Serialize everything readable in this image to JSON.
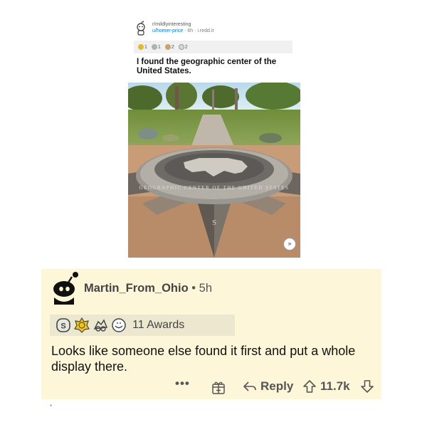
{
  "post": {
    "subreddit": "r/mildlyinteresting",
    "user": "u/homer-price",
    "meta_rest": " · 6h · i.redd.it",
    "awards": [
      "1",
      "1",
      "2",
      "2"
    ],
    "title": "I found the geographic center of the United States.",
    "photo": {
      "ring_text": "GEOGRAPHIC CENTER OF THE UNITED STATES",
      "compass_letter": "S"
    }
  },
  "comment": {
    "username": "Martin_From_Ohio",
    "separator": "•",
    "time": "5h",
    "awards_count": "11 Awards",
    "body": "Looks like someone else found it first and put a whole display there.",
    "actions": {
      "more": "•••",
      "reply": "Reply",
      "score": "11.7k"
    }
  },
  "colors": {
    "comment_bg": "#fdf6d8",
    "award_bar": "#ece7cf",
    "link_blue": "#0079d3"
  }
}
